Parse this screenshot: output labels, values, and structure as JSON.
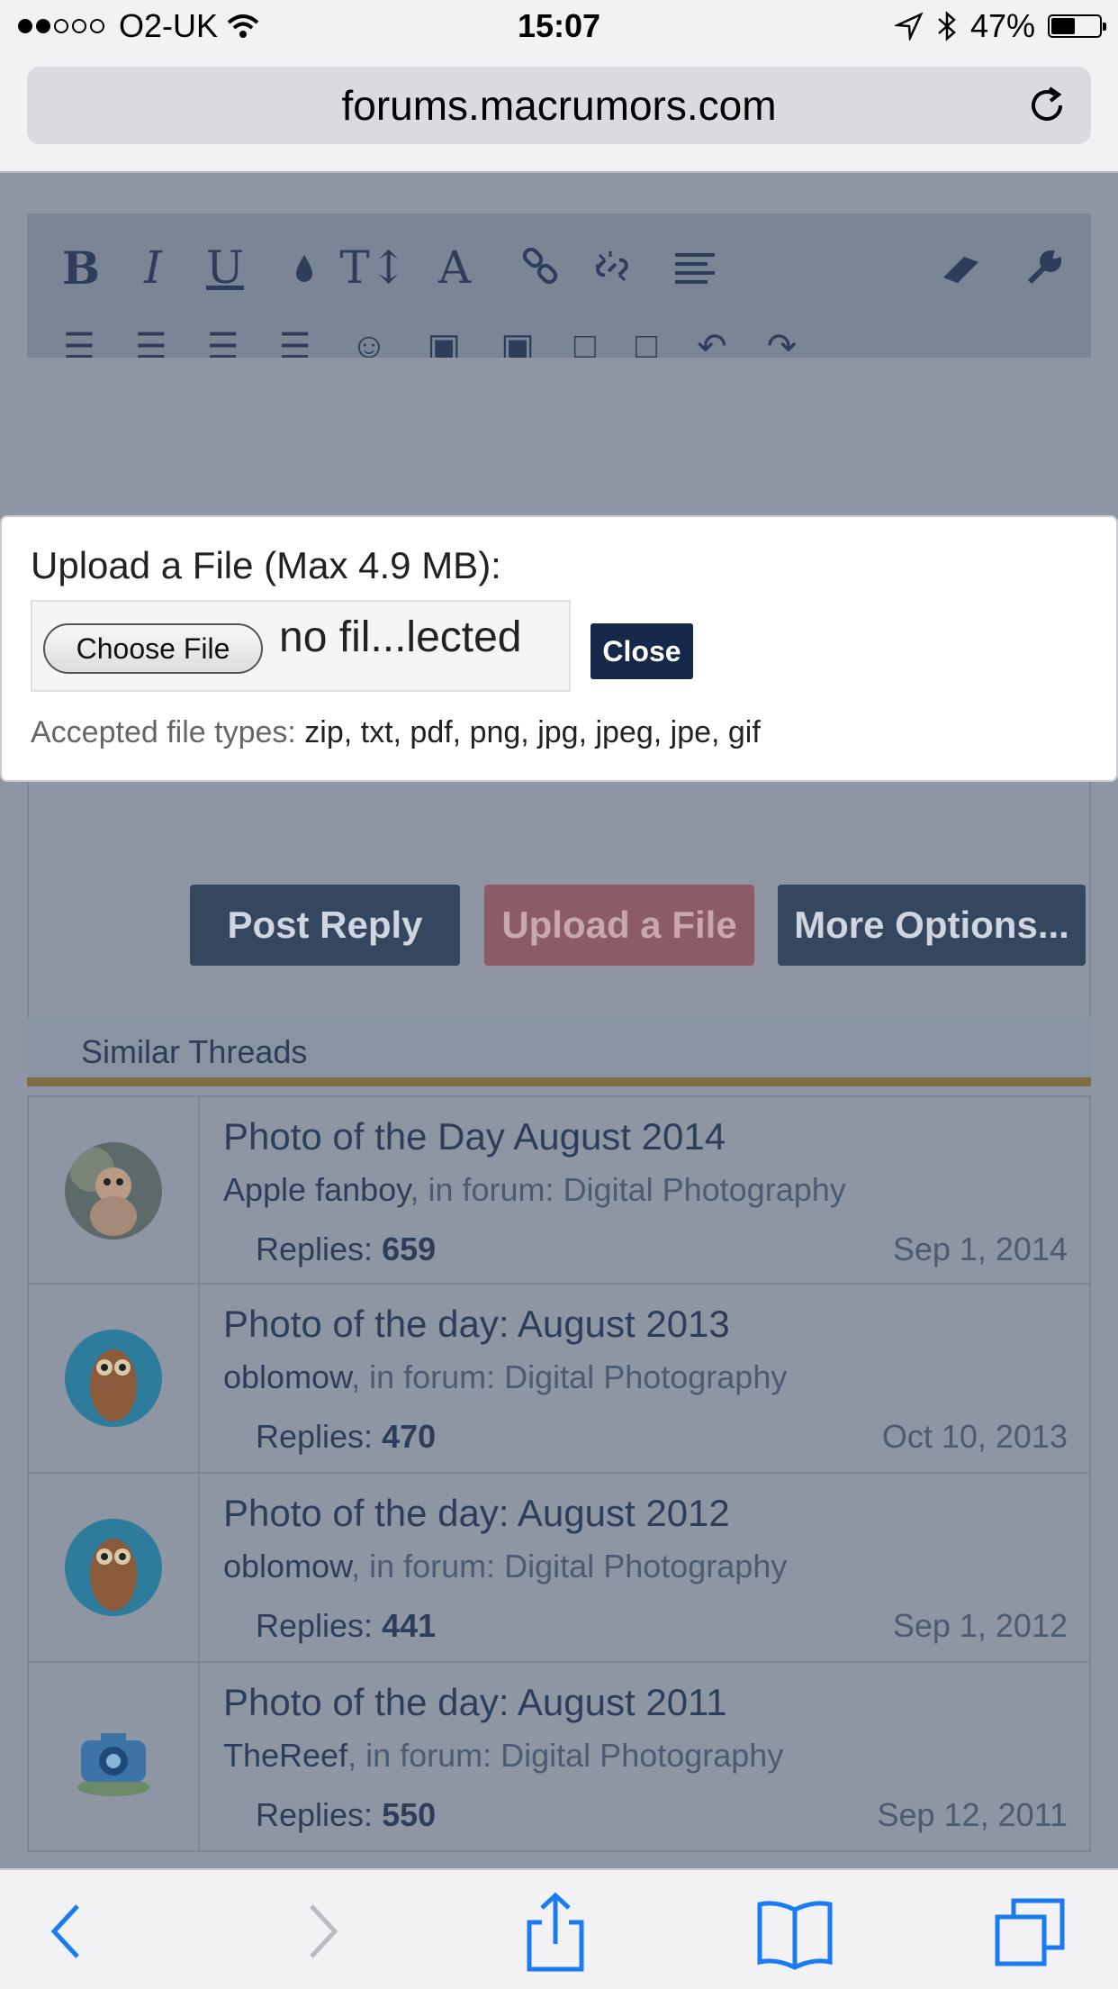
{
  "status": {
    "carrier": "O2-UK",
    "time": "15:07",
    "battery": "47%",
    "signal_dots": 5,
    "signal_filled": 2,
    "battery_level": 0.47
  },
  "browser": {
    "url": "forums.macrumors.com"
  },
  "editor_toolbar": {
    "items": [
      "bold-icon",
      "italic-icon",
      "underline-icon",
      "color-icon",
      "text-size-icon",
      "font-icon",
      "link-icon",
      "unlink-icon",
      "align-icon",
      "eraser-icon",
      "wrench-icon"
    ]
  },
  "buttons": {
    "post_reply": "Post Reply",
    "upload_file": "Upload a File",
    "more_options": "More Options..."
  },
  "upload_panel": {
    "title": "Upload a File (Max 4.9 MB):",
    "choose_file": "Choose File",
    "no_file": "no fil...lected",
    "close": "Close",
    "accepted_label": "Accepted file types:",
    "accepted_types": "zip, txt, pdf, png, jpg, jpeg, jpe, gif"
  },
  "similar": {
    "heading": "Similar Threads",
    "in_forum_text": ", in forum: ",
    "replies_label": "Replies:",
    "threads": [
      {
        "title": "Photo of the Day August 2014",
        "author": "Apple fanboy",
        "forum": "Digital Photography",
        "replies": "659",
        "date": "Sep 1, 2014",
        "avatar": "monkey-avatar"
      },
      {
        "title": "Photo of the day: August 2013",
        "author": "oblomow",
        "forum": "Digital Photography",
        "replies": "470",
        "date": "Oct 10, 2013",
        "avatar": "owl-avatar"
      },
      {
        "title": "Photo of the day: August 2012",
        "author": "oblomow",
        "forum": "Digital Photography",
        "replies": "441",
        "date": "Sep 1, 2012",
        "avatar": "owl-avatar"
      },
      {
        "title": "Photo of the day: August 2011",
        "author": "TheReef",
        "forum": "Digital Photography",
        "replies": "550",
        "date": "Sep 12, 2011",
        "avatar": "camera-avatar"
      }
    ]
  },
  "bottom_bar": {
    "items": [
      "back-icon",
      "forward-icon",
      "share-icon",
      "bookmarks-icon",
      "tabs-icon"
    ]
  }
}
